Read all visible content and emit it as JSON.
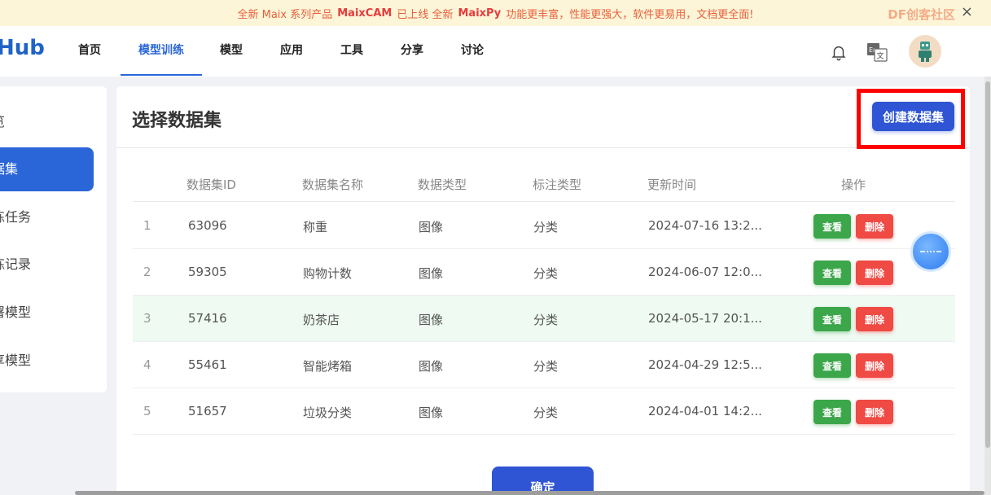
{
  "banner": {
    "prefix": "全新 Maix 系列产品",
    "product1": "MaixCAM",
    "middle": "已上线 全新",
    "product2": "MaixPy",
    "suffix": "功能更丰富，性能更强大，软件更易用，文档更全面!",
    "watermark": "DF创客社区",
    "close_icon": "×"
  },
  "nav": {
    "logo": "Hub",
    "items": [
      "首页",
      "模型训练",
      "模型",
      "应用",
      "工具",
      "分享",
      "讨论"
    ],
    "active": "模型训练"
  },
  "sidebar": {
    "items": [
      "览",
      "据集",
      "练任务",
      "练记录",
      "署模型",
      "享模型"
    ],
    "active_index": 1
  },
  "panel": {
    "title": "选择数据集",
    "create_label": "创建数据集",
    "confirm_label": "确定"
  },
  "table": {
    "headers": [
      "数据集ID",
      "数据集名称",
      "数据类型",
      "标注类型",
      "更新时间",
      "操作"
    ],
    "rows": [
      {
        "index": "1",
        "id": "63096",
        "name": "称重",
        "data_type": "图像",
        "label_type": "分类",
        "updated": "2024-07-16 13:2..."
      },
      {
        "index": "2",
        "id": "59305",
        "name": "购物计数",
        "data_type": "图像",
        "label_type": "分类",
        "updated": "2024-06-07 12:0..."
      },
      {
        "index": "3",
        "id": "57416",
        "name": "奶茶店",
        "data_type": "图像",
        "label_type": "分类",
        "updated": "2024-05-17 20:1..."
      },
      {
        "index": "4",
        "id": "55461",
        "name": "智能烤箱",
        "data_type": "图像",
        "label_type": "分类",
        "updated": "2024-04-29 12:5..."
      },
      {
        "index": "5",
        "id": "51657",
        "name": "垃圾分类",
        "data_type": "图像",
        "label_type": "分类",
        "updated": "2024-04-01 14:2..."
      }
    ],
    "view_label": "查看",
    "delete_label": "删除",
    "highlighted_row": 3
  },
  "colors": {
    "primary": "#2f55d4",
    "nav_active": "#2b66d9",
    "view": "#3ca64a",
    "delete": "#ef4a43",
    "highlight_box": "#ff0000",
    "banner_bg": "#fdf5d8"
  },
  "icons": {
    "notification": "bell-icon",
    "language": "translate-icon",
    "close": "close-icon",
    "float": "assistant-ball-icon"
  }
}
